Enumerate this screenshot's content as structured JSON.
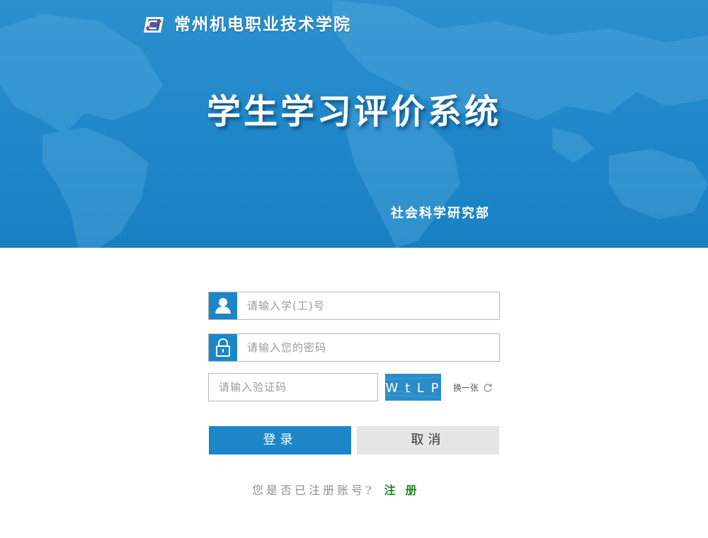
{
  "header": {
    "school_name": "常州机电职业技术学院",
    "system_title": "学生学习评价系统",
    "department": "社会科学研究部"
  },
  "form": {
    "username_placeholder": "请输入学(工)号",
    "password_placeholder": "请输入您的密码",
    "captcha_placeholder": "请输入验证码",
    "captcha_text": "W t L P",
    "refresh_label": "换一张",
    "login_label": "登录",
    "cancel_label": "取消"
  },
  "footer": {
    "question": "您是否已注册账号?",
    "register_link": "注册"
  },
  "colors": {
    "primary": "#1b87c9",
    "banner": "#2a8dcf",
    "register_link": "#1f8a1f"
  },
  "icons": {
    "logo": "school-logo-icon",
    "user": "user-icon",
    "lock": "lock-icon",
    "refresh": "refresh-icon"
  }
}
